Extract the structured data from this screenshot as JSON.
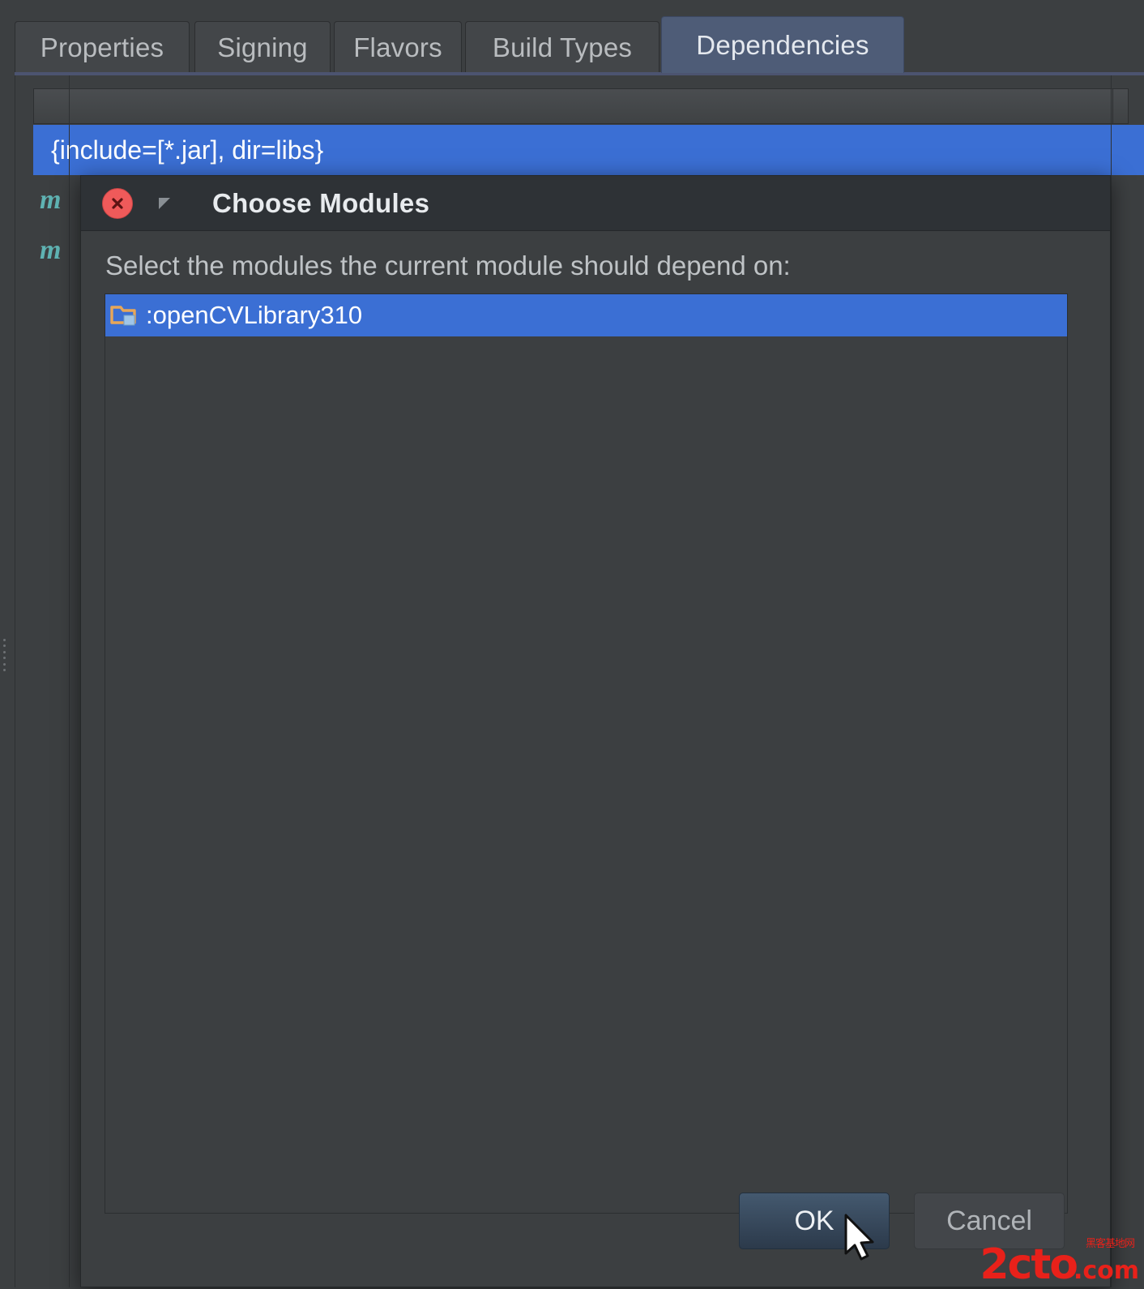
{
  "window": {
    "tabs": [
      {
        "label": "Properties",
        "active": false
      },
      {
        "label": "Signing",
        "active": false
      },
      {
        "label": "Flavors",
        "active": false
      },
      {
        "label": "Build Types",
        "active": false
      },
      {
        "label": "Dependencies",
        "active": true
      }
    ],
    "dependencies": {
      "rows": [
        {
          "glyph": "",
          "text": "{include=[*.jar], dir=libs}",
          "selected": true
        },
        {
          "glyph": "m",
          "text": "",
          "selected": false
        },
        {
          "glyph": "m",
          "text": "",
          "selected": false
        }
      ]
    }
  },
  "dialog": {
    "title": "Choose Modules",
    "close_icon": "close-icon",
    "minimize_icon": "minimize-icon",
    "prompt": "Select the modules the current module should depend on:",
    "modules": [
      {
        "icon": "module-folder-icon",
        "name": ":openCVLibrary310",
        "selected": true
      }
    ],
    "buttons": {
      "ok": "OK",
      "cancel": "Cancel"
    }
  },
  "watermark": {
    "main": "2cto",
    "suffix": ".com",
    "cn": "黑客基地网"
  },
  "colors": {
    "selection_blue": "#3b6fd4",
    "active_tab": "#4e5c77",
    "panel": "#3c3f41",
    "close_red": "#ef5a5a",
    "module_glyph_teal": "#5fb3b3"
  }
}
